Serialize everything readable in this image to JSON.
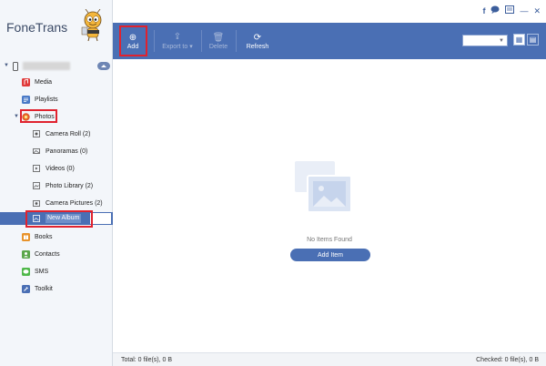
{
  "app": {
    "brand": "FoneTrans"
  },
  "window_icons": [
    "facebook-icon",
    "chat-icon",
    "feedback-icon",
    "minimize-icon",
    "close-icon"
  ],
  "toolbar": {
    "add": "Add",
    "export": "Export to",
    "delete": "Delete",
    "refresh": "Refresh"
  },
  "sidebar": {
    "items": [
      {
        "label": "Media",
        "icon": "media-icon",
        "color": "#e03a3a"
      },
      {
        "label": "Playlists",
        "icon": "playlists-icon",
        "color": "#4a7ac7"
      },
      {
        "label": "Photos",
        "icon": "photos-icon",
        "color": "#e25a2a"
      },
      {
        "label": "Camera Roll (2)",
        "icon": "camera-roll-icon"
      },
      {
        "label": "Panoramas (0)",
        "icon": "panoramas-icon"
      },
      {
        "label": "Videos (0)",
        "icon": "videos-icon"
      },
      {
        "label": "Photo Library (2)",
        "icon": "photo-library-icon"
      },
      {
        "label": "Camera Pictures (2)",
        "icon": "camera-pictures-icon"
      },
      {
        "label": "New Album",
        "icon": "album-icon"
      },
      {
        "label": "Books",
        "icon": "books-icon",
        "color": "#e8932b"
      },
      {
        "label": "Contacts",
        "icon": "contacts-icon",
        "color": "#5aa64a"
      },
      {
        "label": "SMS",
        "icon": "sms-icon",
        "color": "#4fb84a"
      },
      {
        "label": "Toolkit",
        "icon": "toolkit-icon",
        "color": "#4a6fb4"
      }
    ]
  },
  "main": {
    "empty_text": "No Items Found",
    "add_item": "Add Item"
  },
  "status": {
    "total": "Total: 0 file(s), 0 B",
    "checked": "Checked: 0 file(s), 0 B"
  },
  "colors": {
    "accent": "#4a6fb4",
    "highlight": "#e0222e"
  }
}
